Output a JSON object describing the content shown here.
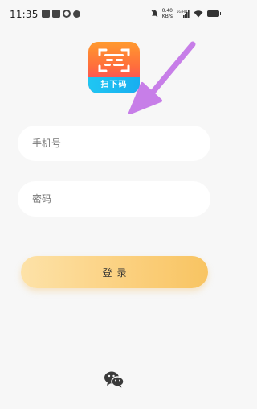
{
  "status_bar": {
    "time": "11:35",
    "net_speed_value": "0.40",
    "net_speed_unit": "KB/s",
    "network_type": "5G HD"
  },
  "logo": {
    "label": "扫下码"
  },
  "form": {
    "phone_placeholder": "手机号",
    "password_placeholder": "密码",
    "login_label": "登录"
  },
  "colors": {
    "accent_button": "#fbcf7c",
    "arrow": "#c77ee8",
    "logo_ribbon": "#1fc6f2"
  },
  "icons": {
    "login_alt": "wechat-icon"
  }
}
